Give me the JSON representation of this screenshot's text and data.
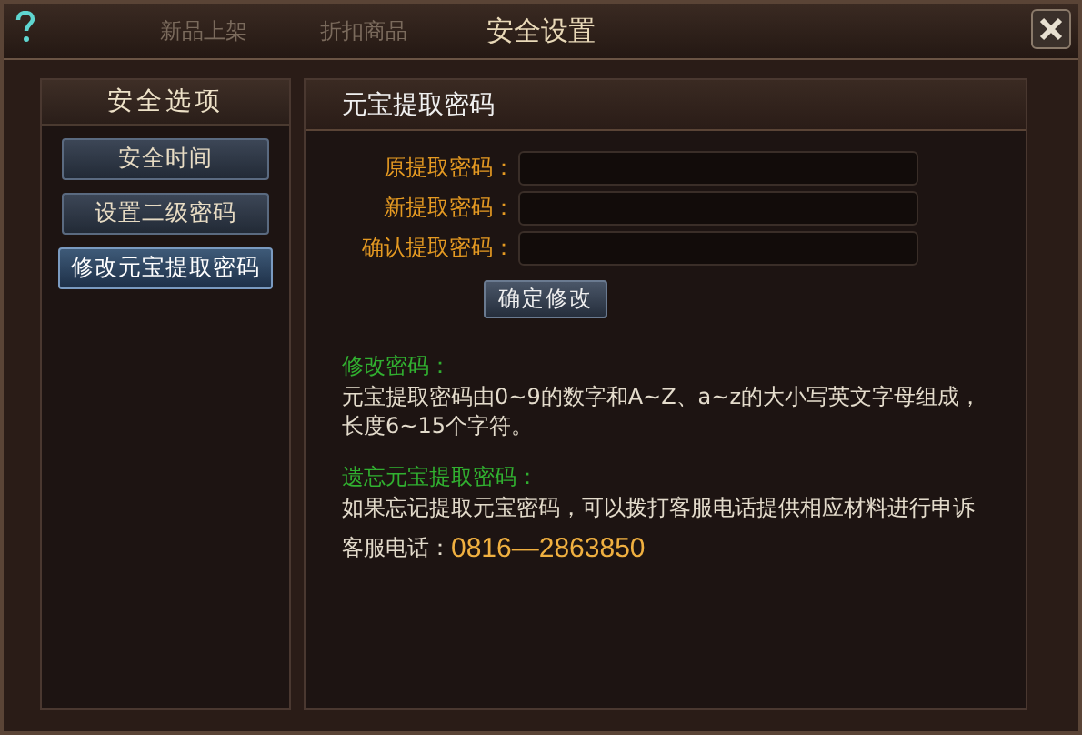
{
  "background_tabs": [
    {
      "label": "新品上架"
    },
    {
      "label": "折扣商品"
    }
  ],
  "window": {
    "title": "安全设置"
  },
  "sidebar": {
    "title": "安全选项",
    "items": [
      {
        "label": "安全时间",
        "selected": false
      },
      {
        "label": "设置二级密码",
        "selected": false
      },
      {
        "label": "修改元宝提取密码",
        "selected": true
      }
    ]
  },
  "panel": {
    "title": "元宝提取密码",
    "fields": [
      {
        "label": "原提取密码："
      },
      {
        "label": "新提取密码："
      },
      {
        "label": "确认提取密码："
      }
    ],
    "submit": "确定修改",
    "sections": [
      {
        "heading": "修改密码：",
        "lines": [
          "元宝提取密码由0~9的数字和A~Z、a~z的大小写英文字母组成，",
          "长度6~15个字符。"
        ]
      },
      {
        "heading": "遗忘元宝提取密码：",
        "lines": [
          "如果忘记提取元宝密码，可以拨打客服电话提供相应材料进行申诉"
        ]
      }
    ],
    "phone_label": "客服电话：",
    "phone": "0816—2863850"
  }
}
